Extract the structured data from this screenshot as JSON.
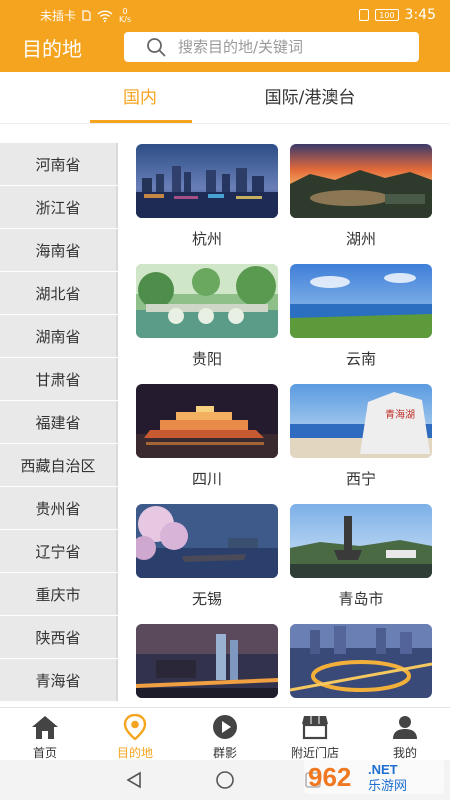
{
  "status_bar": {
    "carrier": "未插卡",
    "speed_value": "0",
    "speed_unit": "K/s",
    "battery": "100",
    "time": "3:45"
  },
  "header": {
    "title": "目的地",
    "search_placeholder": "搜索目的地/关键词"
  },
  "tabs": [
    {
      "label": "国内",
      "active": true
    },
    {
      "label": "国际/港澳台",
      "active": false
    }
  ],
  "sidebar": {
    "items": [
      "河南省",
      "浙江省",
      "海南省",
      "湖北省",
      "湖南省",
      "甘肃省",
      "福建省",
      "西藏自治区",
      "贵州省",
      "辽宁省",
      "重庆市",
      "陕西省",
      "青海省"
    ]
  },
  "destinations": [
    {
      "label": "杭州",
      "icon": "city-night-skyline-photo"
    },
    {
      "label": "湖州",
      "icon": "sunset-lake-city-photo"
    },
    {
      "label": "贵阳",
      "icon": "stone-bridge-park-photo"
    },
    {
      "label": "云南",
      "icon": "blue-lake-shore-photo"
    },
    {
      "label": "四川",
      "icon": "night-river-boat-photo"
    },
    {
      "label": "西宁",
      "icon": "lakeside-stone-photo"
    },
    {
      "label": "无锡",
      "icon": "cherry-blossom-lake-photo"
    },
    {
      "label": "青岛市",
      "icon": "city-monument-photo"
    },
    {
      "label": "",
      "icon": "city-towers-night-photo"
    },
    {
      "label": "",
      "icon": "highway-interchange-night-photo"
    }
  ],
  "stone_inscription": "青海湖",
  "bottom_nav": [
    {
      "label": "首页",
      "icon": "home-icon",
      "active": false
    },
    {
      "label": "目的地",
      "icon": "location-pin-icon",
      "active": true
    },
    {
      "label": "群影",
      "icon": "play-icon",
      "active": false
    },
    {
      "label": "附近门店",
      "icon": "store-icon",
      "active": false
    },
    {
      "label": "我的",
      "icon": "user-icon",
      "active": false
    }
  ],
  "watermark": {
    "brand": "962",
    "domain": ".NET",
    "site": "乐游网"
  },
  "colors": {
    "accent": "#F5A41F",
    "sidebar_bg": "#E9E9E9",
    "text": "#333333"
  }
}
